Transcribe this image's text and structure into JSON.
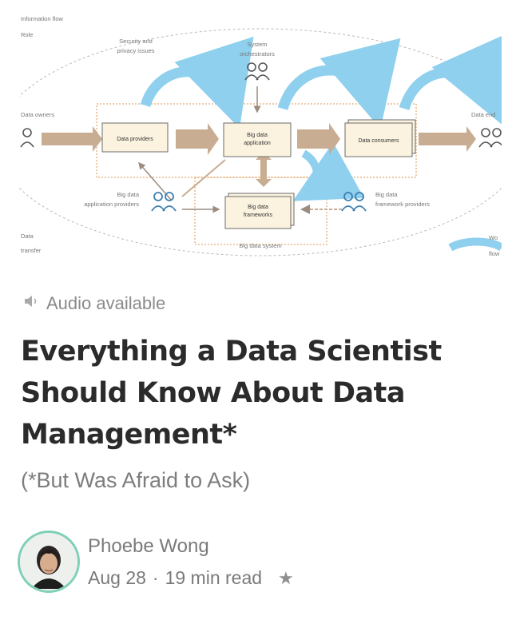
{
  "diagram": {
    "labels": {
      "top_left": "Information flow",
      "top_left_sub": "Role",
      "security": "Security and",
      "security_sub": "privacy issues",
      "orchestrators": "System",
      "orchestrators_sub": "orchestrators",
      "owners": "Data owners",
      "consumers_right": "Data end",
      "data_providers": "Data providers",
      "big_data_app": "Big data",
      "big_data_app_sub": "application",
      "data_consumers": "Data consumers",
      "app_providers": "Big data",
      "app_providers_sub": "application providers",
      "frameworks": "Big data",
      "frameworks_sub": "frameworks",
      "framework_providers": "Big data",
      "framework_providers_sub": "framework providers",
      "big_data_system": "Big data system",
      "bottom_left": "Data",
      "bottom_left_sub": "transfer",
      "bottom_right": "Wo",
      "bottom_right_sub": "flow"
    }
  },
  "audio": {
    "label": "Audio available",
    "icon": "speaker-icon"
  },
  "article": {
    "title": "Everything a Data Scientist Should Know About Data Management*",
    "subtitle": "(*But Was Afraid to Ask)"
  },
  "author": {
    "name": "Phoebe Wong",
    "date": "Aug 28",
    "separator": "·",
    "read_time": "19 min read",
    "star_icon": "star-icon"
  },
  "colors": {
    "accent_blue": "#8fd0ee",
    "box_fill": "#fbf3df",
    "arrow_fill": "#c9ad92",
    "frame_border": "#e9b98a",
    "avatar_ring": "#7fd0b8"
  }
}
